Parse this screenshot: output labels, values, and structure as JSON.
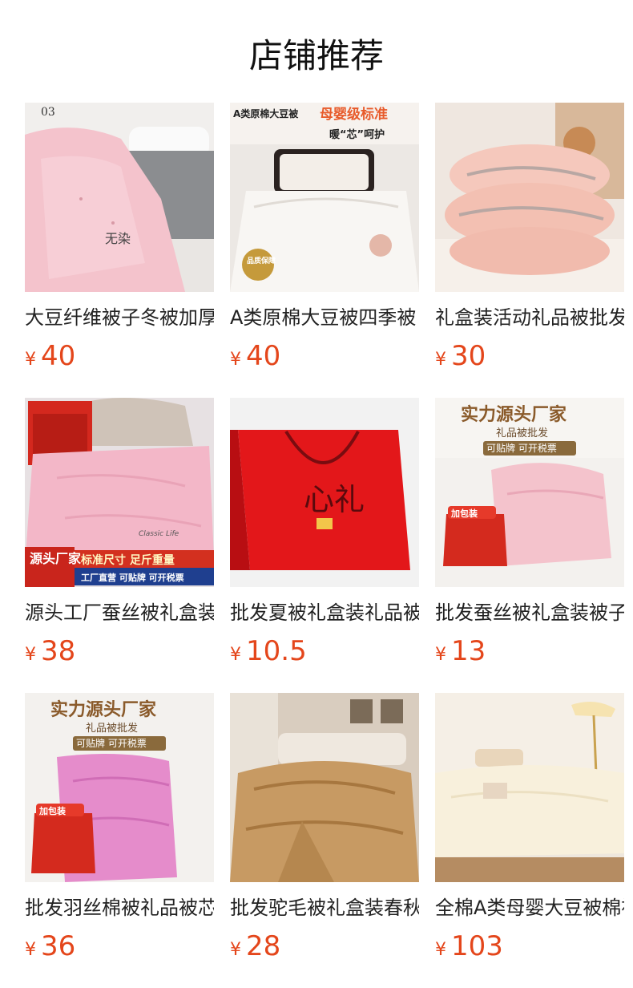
{
  "section": {
    "title": "店铺推荐"
  },
  "products": [
    {
      "name": "大豆纤维被子冬被加厚",
      "price": "40",
      "currency": "¥",
      "image": {
        "corner_label": "03",
        "stamp": "无染"
      }
    },
    {
      "name": "A类原棉大豆被四季被",
      "price": "40",
      "currency": "¥",
      "image": {
        "top_label": "A类原棉大豆被",
        "headline": "母婴级标准",
        "tagline": "暖“芯”呵护",
        "badge": "品质保障"
      }
    },
    {
      "name": "礼盒装活动礼品被批发",
      "price": "30",
      "currency": "¥",
      "image": {}
    },
    {
      "name": "源头工厂蚕丝被礼盒装",
      "price": "38",
      "currency": "¥",
      "image": {
        "badge_left": "源头厂家",
        "banner": "标准尺寸 足斤重量",
        "sub_banner": "工厂直营 可贴牌 可开税票",
        "script": "Classic Life"
      }
    },
    {
      "name": "批发夏被礼盒装礼品被",
      "price": "10.5",
      "currency": "¥",
      "image": {
        "box_text": "心礼"
      }
    },
    {
      "name": "批发蚕丝被礼盒装被子",
      "price": "13",
      "currency": "¥",
      "image": {
        "headline": "实力源头厂家",
        "subline": "礼品被批发",
        "tag": "可贴牌 可开税票",
        "box_label": "加包装"
      }
    },
    {
      "name": "批发羽丝棉被礼品被芯",
      "price": "36",
      "currency": "¥",
      "image": {
        "headline": "实力源头厂家",
        "subline": "礼品被批发",
        "tag": "可贴牌 可开税票",
        "box_label": "加包装"
      }
    },
    {
      "name": "批发驼毛被礼盒装春秋",
      "price": "28",
      "currency": "¥",
      "image": {}
    },
    {
      "name": "全棉A类母婴大豆被棉被",
      "price": "103",
      "currency": "¥",
      "image": {}
    }
  ]
}
